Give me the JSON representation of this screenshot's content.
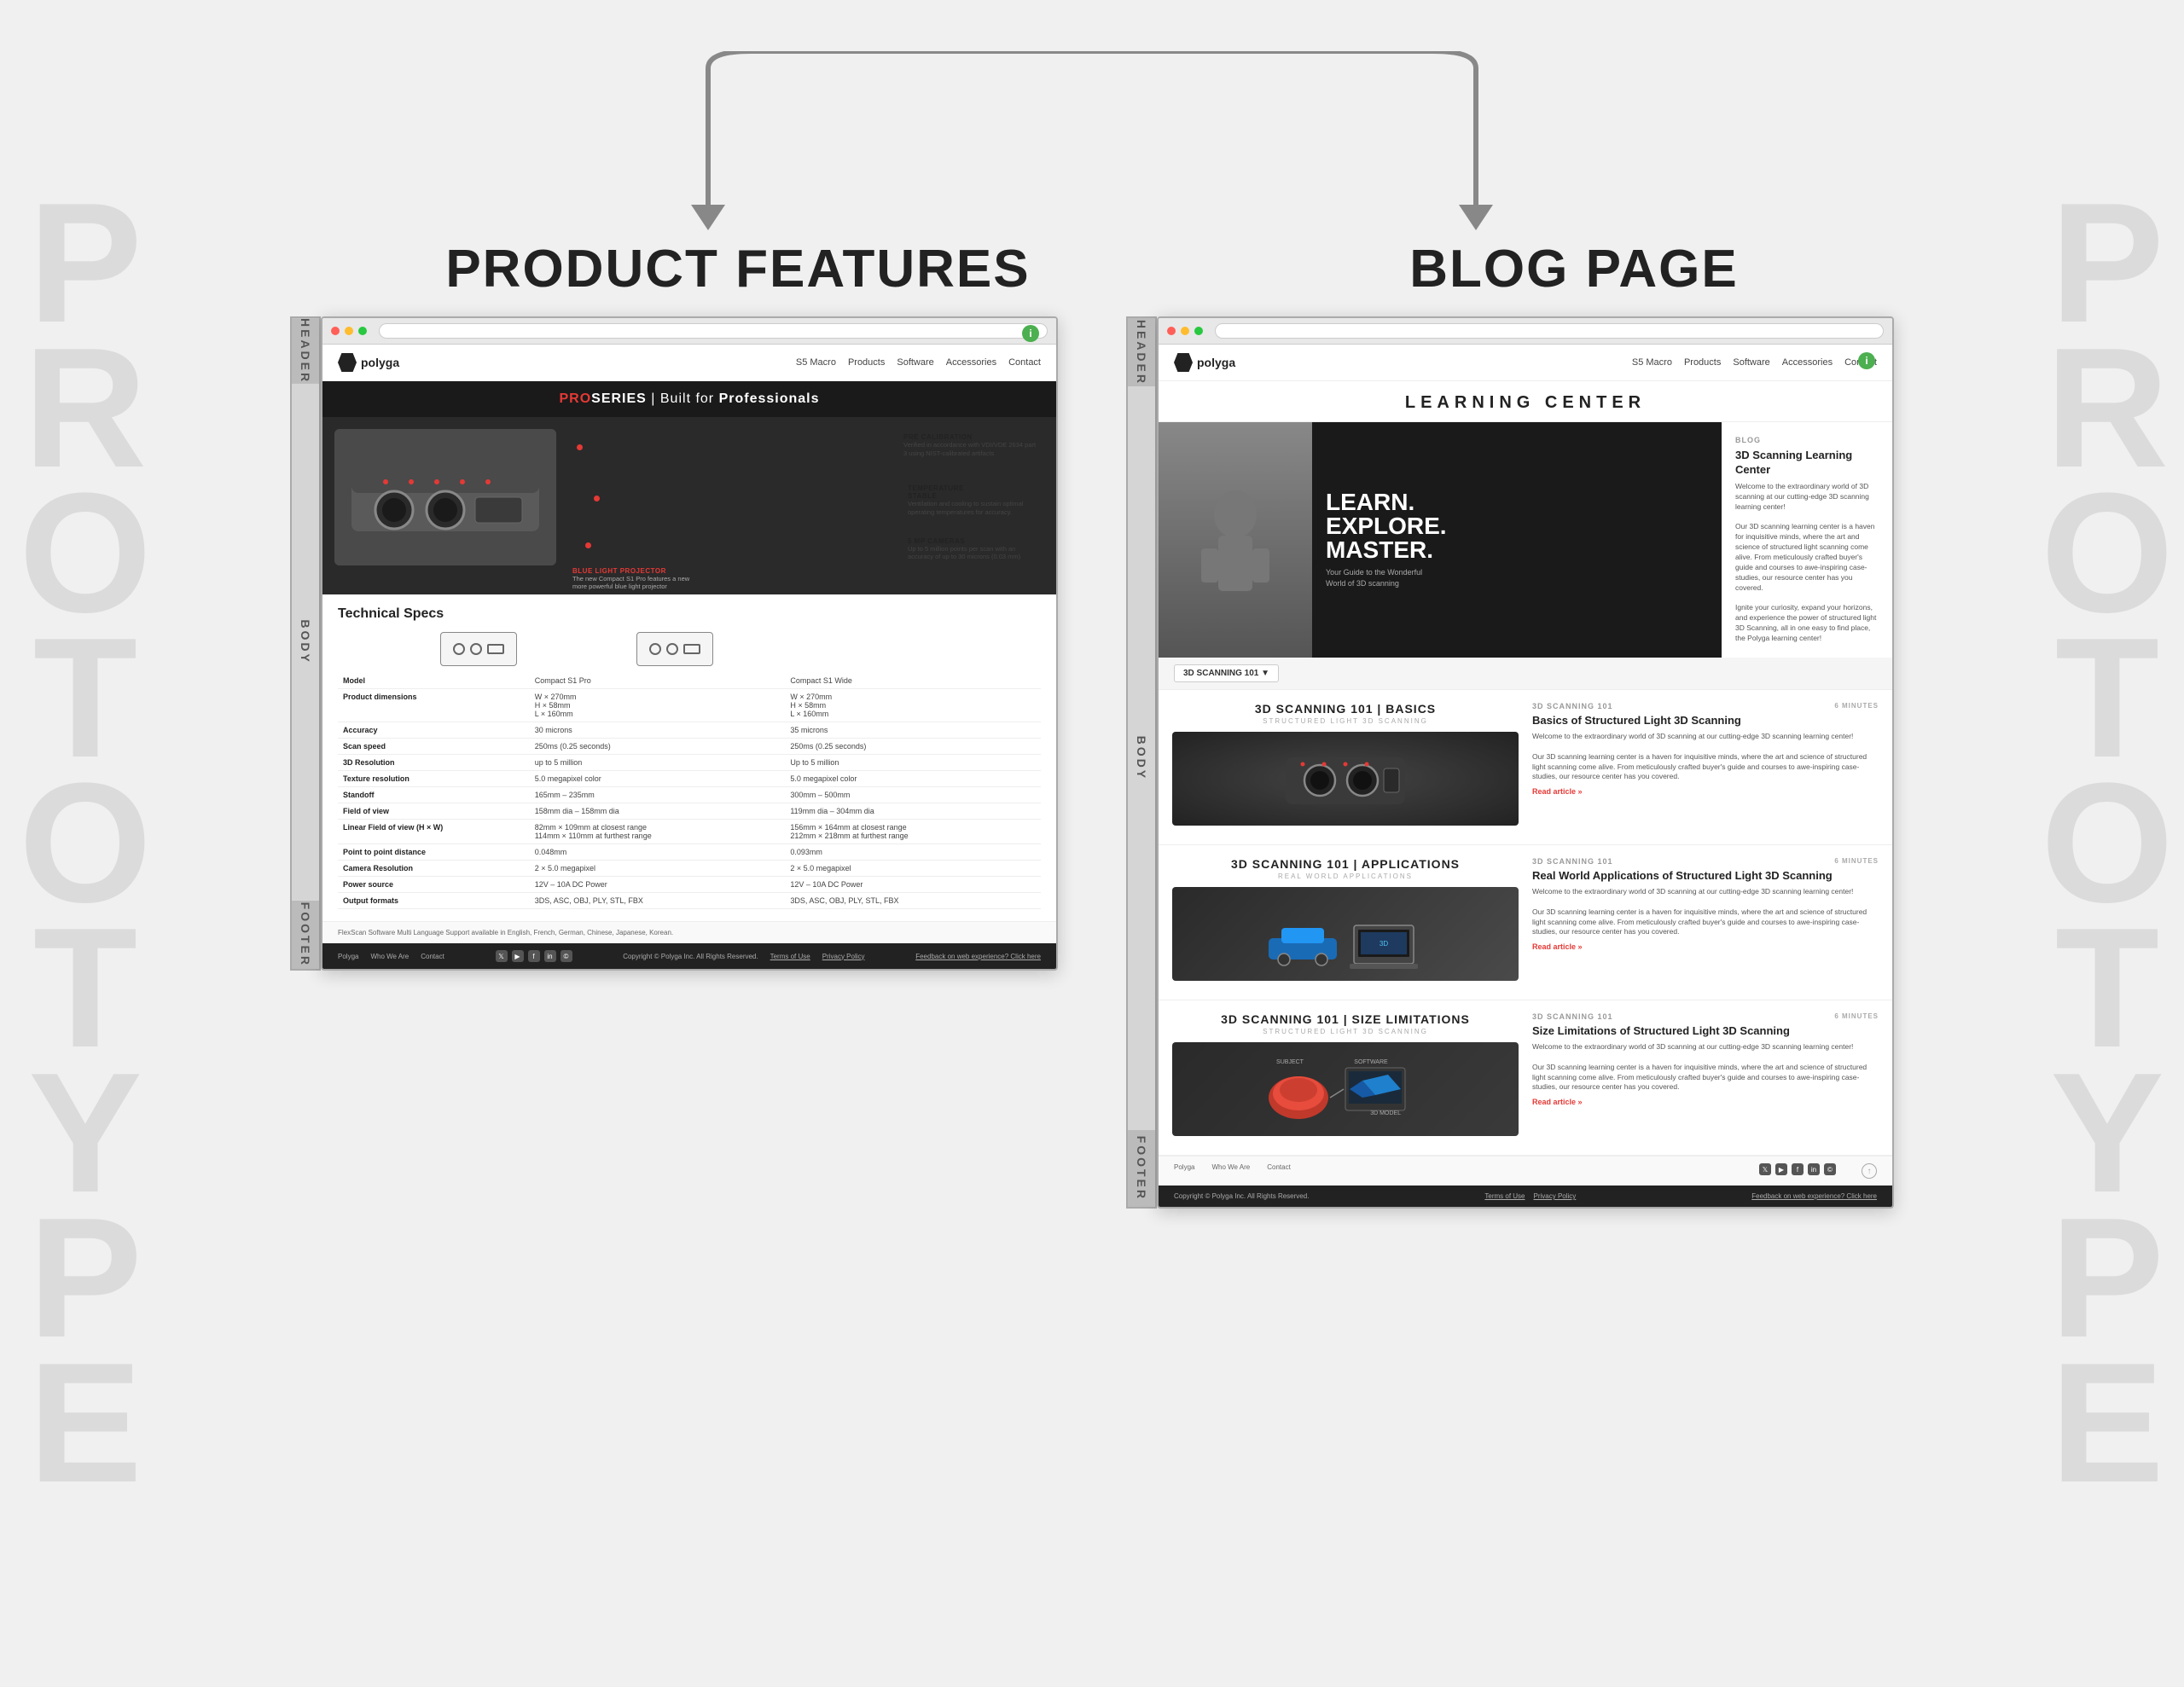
{
  "background_color": "#f0f0f0",
  "watermark_text": "PROTOTYPE",
  "section_labels": {
    "product_features": "PRODUCT FEATURES",
    "blog_page": "BLOG PAGE",
    "header": "HEADER",
    "body": "BODY",
    "footer": "FOOTER"
  },
  "product_page": {
    "nav": {
      "logo": "polyga",
      "links": [
        "S5 Macro",
        "Products",
        "Software",
        "Accessories",
        "Contact"
      ]
    },
    "hero": {
      "proseries_label": "PROSERIES",
      "built_for": "Built for",
      "professionals": "Professionals"
    },
    "callouts": [
      {
        "title": "PRE CALIBRATION",
        "text": "Verified in accordance with VDI/VDE 2634 part 3 using NIST-calibrated artifacts"
      },
      {
        "title": "TEMPERATURE STABLE",
        "text": "Ventilation and cooling to sustain optimal operating temperatures for accuracy."
      },
      {
        "title": "5 MP CAMERAS",
        "text": "Up to 5 million points per scan with an accuracy of up to 30 microns (0.03 mm)"
      },
      {
        "title": "BLUE LIGHT PROJECTOR",
        "text": "The new Compact S1 Pro features a new more powerful blue light projector"
      }
    ],
    "tech_specs": {
      "title": "Technical Specs",
      "models": [
        "Compact S1 Pro",
        "Compact S1 Wide"
      ],
      "rows": [
        {
          "label": "Model",
          "col1": "Compact S1 Pro",
          "col2": "Compact S1 Wide"
        },
        {
          "label": "Product dimensions",
          "col1": "W × 270mm\nH × 58mm\nL × 160mm",
          "col2": "W × 270mm\nH × 58mm\nL × 160mm"
        },
        {
          "label": "Accuracy",
          "col1": "30 microns",
          "col2": "35 microns"
        },
        {
          "label": "Scan speed",
          "col1": "250ms (0.25 seconds)",
          "col2": "250ms (0.25 seconds)"
        },
        {
          "label": "3D Resolution",
          "col1": "up to 5 million",
          "col2": "Up to 5 million"
        },
        {
          "label": "Texture resolution",
          "col1": "5.0 megapixel color",
          "col2": "5.0 megapixel color"
        },
        {
          "label": "Standoff",
          "col1": "165mm – 235mm",
          "col2": "300mm – 500mm"
        },
        {
          "label": "Field of view",
          "col1": "158mm dia – 158mm dia",
          "col2": "119mm dia – 304mm dia"
        },
        {
          "label": "Linear Field of view (H × W)",
          "col1": "82mm × 109mm at closest range\n114mm × 110mm at furthest range",
          "col2": "156mm × 164mm at closest range\n212mm × 218mm at furthest range"
        },
        {
          "label": "Point to point distance",
          "col1": "0.048mm",
          "col2": "0.093mm"
        },
        {
          "label": "Camera Resolution",
          "col1": "2 × 5.0 megapixel",
          "col2": "2 × 5.0 megapixel"
        },
        {
          "label": "Power source",
          "col1": "12V – 10A DC Power",
          "col2": "12V – 10A DC Power"
        },
        {
          "label": "Output formats",
          "col1": "3DS, ASC, OBJ, PLY, STL, FBX",
          "col2": "3DS, ASC, OBJ, PLY, STL, FBX"
        }
      ]
    },
    "footer": {
      "multilang": "FlexScan Software Multi Language Support available in English, French, German, Chinese, Japanese, Korean.",
      "links": [
        "Polyga",
        "Who We Are",
        "Contact"
      ],
      "social": [
        "x",
        "yt",
        "fb",
        "in",
        "©"
      ],
      "copyright": "Copyright © Polyga Inc. All Rights Reserved.",
      "terms": "Terms of Use",
      "privacy": "Privacy Policy",
      "feedback": "Feedback on web experience? Click here"
    }
  },
  "blog_page": {
    "nav": {
      "logo": "polyga",
      "links": [
        "S5 Macro",
        "Products",
        "Software",
        "Accessories",
        "Contact"
      ]
    },
    "learning_center": {
      "title": "LEARNING CENTER"
    },
    "hero": {
      "main_text_lines": [
        "LEARN.",
        "EXPLORE.",
        "MASTER."
      ],
      "sub_text": "Your Guide to the Wonderful World of 3D scanning",
      "blog_label": "BLOG",
      "article_title": "3D Scanning Learning Center",
      "article_text": "Welcome to the extraordinary world of 3D scanning at our cutting-edge 3D scanning learning center!\n\nOur 3D scanning learning center is a haven for inquisitive minds, where the art and science of structured light scanning come alive. From meticulously crafted buyer's guide and courses to awe-inspiring case-studies, our resource center has you covered.\n\nIgnite your curiosity, expand your horizons, and experience the power of structured light 3D Scanning, all in one easy to find place, the Polyga learning center!"
    },
    "filter": {
      "label": "3D SCANNING 101",
      "chevron": "▼"
    },
    "articles": [
      {
        "section": "3D SCANNING 101",
        "sub": "BASICS",
        "subsub": "STRUCTURED LIGHT 3D SCANNING",
        "section_label": "3D SCANNING 101",
        "minutes": "6 Minutes",
        "title": "Basics of Structured Light 3D Scanning",
        "text": "Welcome to the extraordinary world of 3D scanning at our cutting-edge 3D scanning learning center!\n\nOur 3D scanning learning center is a haven for inquisitive minds, where the art and science of structured light scanning come alive. From meticulously crafted buyer's guide and courses to awe-inspiring case-studies, our resource center has you covered.",
        "read_more": "Read article »",
        "image_type": "scanner"
      },
      {
        "section": "3D SCANNING 101",
        "sub": "APPLICATIONS",
        "subsub": "REAL WORLD APPLICATIONS",
        "section_label": "3D SCANNING 101",
        "minutes": "6 Minutes",
        "title": "Real World Applications of Structured Light 3D Scanning",
        "text": "Welcome to the extraordinary world of 3D scanning at our cutting-edge 3D scanning learning center!\n\nOur 3D scanning learning center is a haven for inquisitive minds, where the art and science of structured light scanning come alive. From meticulously crafted buyer's guide and courses to awe-inspiring case-studies, our resource center has you covered.",
        "read_more": "Read article »",
        "image_type": "car_laptop"
      },
      {
        "section": "3D SCANNING 101",
        "sub": "SIZE LIMITATIONS",
        "subsub": "STRUCTURED LIGHT 3D SCANNING",
        "section_label": "3D SCANNING 101",
        "minutes": "6 Minutes",
        "title": "Size Limitations of Structured Light 3D Scanning",
        "text": "Welcome to the extraordinary world of 3D scanning at our cutting-edge 3D scanning learning center!\n\nOur 3D scanning learning center is a haven for inquisitive minds, where the art and science of structured light scanning come alive. From meticulously crafted buyer's guide and courses to awe-inspiring case-studies, our resource center has you covered.",
        "read_more": "Read article »",
        "image_type": "food_model"
      }
    ],
    "footer": {
      "links": [
        "Polyga",
        "Who We Are",
        "Contact"
      ],
      "social": [
        "x",
        "yt",
        "fb",
        "in",
        "©"
      ],
      "copyright": "Copyright © Polyga Inc. All Rights Reserved.",
      "terms": "Terms of Use",
      "privacy": "Privacy Policy",
      "feedback": "Feedback on web experience? Click here"
    }
  }
}
